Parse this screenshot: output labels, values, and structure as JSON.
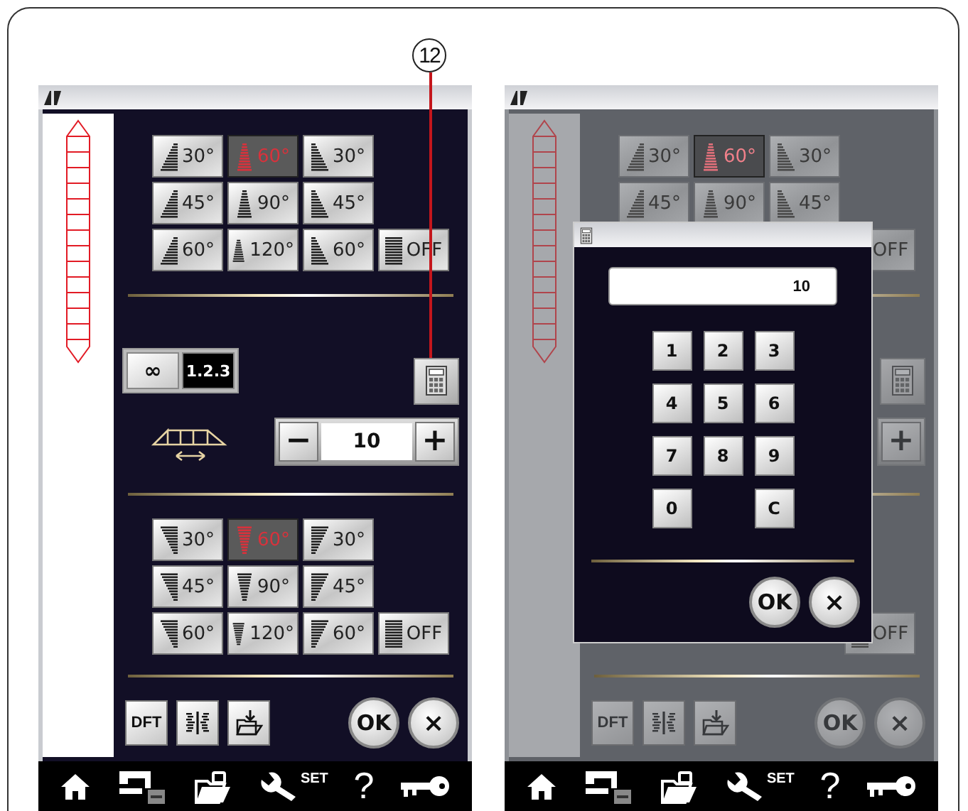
{
  "callout": {
    "label": "12"
  },
  "screens": [
    {
      "dimmed": false,
      "top_grid": [
        [
          {
            "kind": "left",
            "label": "30°",
            "selected": false
          },
          {
            "kind": "center",
            "label": "60°",
            "selected": true
          },
          {
            "kind": "right",
            "label": "30°",
            "selected": false
          }
        ],
        [
          {
            "kind": "left",
            "label": "45°",
            "selected": false
          },
          {
            "kind": "center",
            "label": "90°",
            "selected": false
          },
          {
            "kind": "right",
            "label": "45°",
            "selected": false
          }
        ],
        [
          {
            "kind": "left",
            "label": "60°",
            "selected": false
          },
          {
            "kind": "center",
            "label": "120°",
            "selected": false
          },
          {
            "kind": "right",
            "label": "60°",
            "selected": false
          },
          {
            "kind": "off",
            "label": "OFF",
            "selected": false
          }
        ]
      ],
      "stitch_mode": [
        {
          "kind": "continuous",
          "label": "∞",
          "selected": false
        },
        {
          "kind": "counted",
          "label": "1.2.3",
          "selected": true
        }
      ],
      "width_stepper": {
        "minus": "−",
        "value": "10",
        "plus": "+"
      },
      "bottom_grid": [
        [
          {
            "kind": "left",
            "label": "30°",
            "selected": false
          },
          {
            "kind": "center",
            "label": "60°",
            "selected": true
          },
          {
            "kind": "right",
            "label": "30°",
            "selected": false
          }
        ],
        [
          {
            "kind": "left",
            "label": "45°",
            "selected": false
          },
          {
            "kind": "center",
            "label": "90°",
            "selected": false
          },
          {
            "kind": "right",
            "label": "45°",
            "selected": false
          }
        ],
        [
          {
            "kind": "left",
            "label": "60°",
            "selected": false
          },
          {
            "kind": "center",
            "label": "120°",
            "selected": false
          },
          {
            "kind": "right",
            "label": "60°",
            "selected": false
          },
          {
            "kind": "off",
            "label": "OFF",
            "selected": false
          }
        ]
      ],
      "bottom_buttons": [
        {
          "kind": "text",
          "label": "DFT"
        },
        {
          "kind": "mirror"
        },
        {
          "kind": "save"
        },
        {
          "kind": "ok",
          "label": "OK"
        },
        {
          "kind": "cancel",
          "label": "×"
        }
      ],
      "nav": [
        {
          "kind": "home"
        },
        {
          "kind": "machine"
        },
        {
          "kind": "folder"
        },
        {
          "kind": "settings",
          "label": "SET"
        },
        {
          "kind": "help",
          "label": "?"
        },
        {
          "kind": "key"
        }
      ]
    },
    {
      "dimmed": true,
      "top_grid": [
        [
          {
            "kind": "left",
            "label": "30°",
            "selected": false
          },
          {
            "kind": "center",
            "label": "60°",
            "selected": true
          },
          {
            "kind": "right",
            "label": "30°",
            "selected": false
          }
        ],
        [
          {
            "kind": "left",
            "label": "45°",
            "selected": false
          },
          {
            "kind": "center",
            "label": "90°",
            "selected": false
          },
          {
            "kind": "right",
            "label": "45°",
            "selected": false
          }
        ],
        [
          {
            "kind": "off",
            "label": "OFF",
            "selected": false
          }
        ]
      ],
      "width_stepper": {
        "plus": "+"
      },
      "bottom_grid": [
        [
          {
            "kind": "off",
            "label": "OFF",
            "selected": false
          }
        ]
      ],
      "bottom_buttons": [
        {
          "kind": "text",
          "label": "DFT"
        },
        {
          "kind": "mirror"
        },
        {
          "kind": "save"
        },
        {
          "kind": "ok",
          "label": "OK"
        },
        {
          "kind": "cancel",
          "label": "×"
        }
      ],
      "nav": [
        {
          "kind": "home"
        },
        {
          "kind": "machine"
        },
        {
          "kind": "folder"
        },
        {
          "kind": "settings",
          "label": "SET"
        },
        {
          "kind": "help",
          "label": "?"
        },
        {
          "kind": "key"
        }
      ],
      "dialog": {
        "display": "10",
        "keys": [
          {
            "kind": "digit",
            "label": "1"
          },
          {
            "kind": "digit",
            "label": "2"
          },
          {
            "kind": "digit",
            "label": "3"
          },
          {
            "kind": "digit",
            "label": "4"
          },
          {
            "kind": "digit",
            "label": "5"
          },
          {
            "kind": "digit",
            "label": "6"
          },
          {
            "kind": "digit",
            "label": "7"
          },
          {
            "kind": "digit",
            "label": "8"
          },
          {
            "kind": "digit",
            "label": "9"
          },
          {
            "kind": "digit",
            "label": "0"
          },
          {
            "kind": "clear",
            "label": "C"
          }
        ],
        "buttons": [
          {
            "kind": "ok",
            "label": "OK"
          },
          {
            "kind": "cancel",
            "label": "×"
          }
        ]
      }
    }
  ]
}
